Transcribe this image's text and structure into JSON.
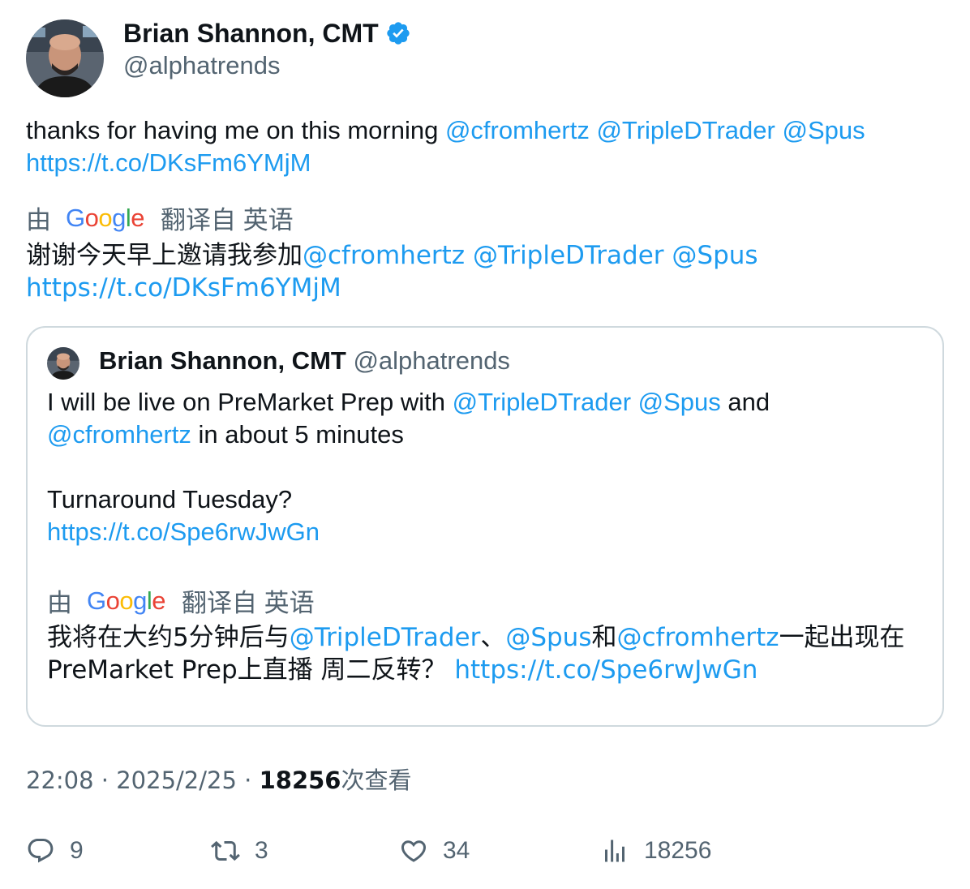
{
  "author": {
    "display_name": "Brian Shannon, CMT",
    "handle": "@alphatrends",
    "verified_icon": "verified-badge-icon",
    "avatar_icon": "avatar-photo"
  },
  "tweet": {
    "text_plain": "thanks for having me on this morning ",
    "mentions": [
      "@cfromhertz",
      "@TripleDTrader",
      "@Spus"
    ],
    "link": "https://t.co/DKsFm6YMjM",
    "translation": {
      "by": "由",
      "logo": "Google",
      "from": "翻译自 英语",
      "text_plain": "谢谢今天早上邀请我参加",
      "mentions": [
        "@cfromhertz",
        "@TripleDTrader",
        "@Spus"
      ],
      "link": "https://t.co/DKsFm6YMjM"
    }
  },
  "quote": {
    "display_name": "Brian Shannon, CMT",
    "handle": "@alphatrends",
    "line1_plain": "I will be live on PreMarket Prep with ",
    "line1_mention1": "@TripleDTrader",
    "line1_mention2": "@Spus",
    "line1_and": " and",
    "line2_mention": "@cfromhertz",
    "line2_rest": " in about 5 minutes",
    "line3": "Turnaround Tuesday?",
    "link": "https://t.co/Spe6rwJwGn",
    "translation": {
      "by": "由",
      "logo": "Google",
      "from": "翻译自 英语",
      "part1": "我将在大约5分钟后与",
      "mention1": "@TripleDTrader",
      "sep": "、",
      "mention2": "@Spus",
      "and": "和",
      "mention3": "@cfromhertz",
      "part2": "一起出现在",
      "part3": "PreMarket Prep上直播 周二反转？ ",
      "link": "https://t.co/Spe6rwJwGn"
    }
  },
  "meta": {
    "time": "22:08",
    "date": "2025/2/25",
    "views": "18256",
    "views_suffix": "次查看"
  },
  "actions": {
    "replies": "9",
    "retweets": "3",
    "likes": "34",
    "views": "18256"
  },
  "colors": {
    "link": "#1d9bf0",
    "muted": "#536471",
    "border": "#cfd9de",
    "verified": "#1d9bf0"
  }
}
